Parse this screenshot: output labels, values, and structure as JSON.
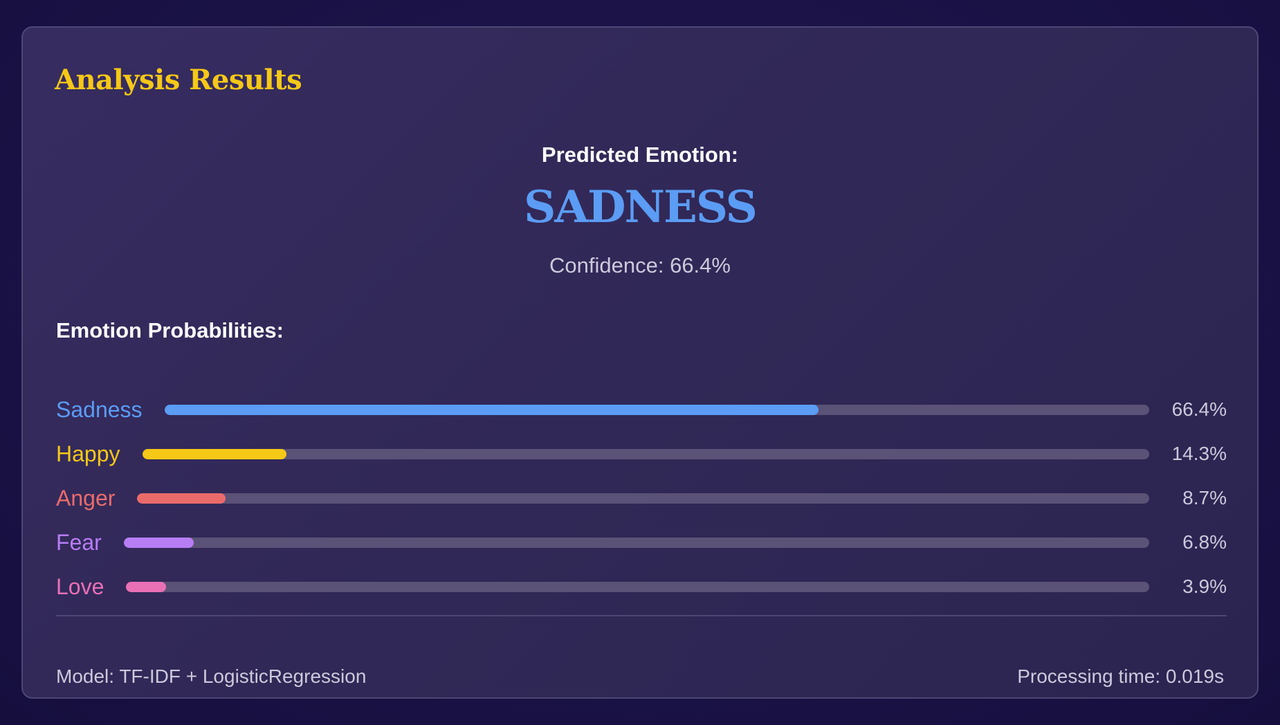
{
  "title": "Analysis Results",
  "prediction": {
    "label": "Predicted Emotion:",
    "emotion": "SADNESS",
    "emotion_color": "#5b9cf5",
    "confidence": "Confidence: 66.4%"
  },
  "probabilities_heading": "Emotion Probabilities:",
  "probabilities": [
    {
      "label": "Sadness",
      "percent_text": "66.4%",
      "value": 66.4,
      "color": "#5b9cf5"
    },
    {
      "label": "Happy",
      "percent_text": "14.3%",
      "value": 14.3,
      "color": "#f6c816"
    },
    {
      "label": "Anger",
      "percent_text": "8.7%",
      "value": 8.7,
      "color": "#eb6b6b"
    },
    {
      "label": "Fear",
      "percent_text": "6.8%",
      "value": 6.8,
      "color": "#b77df5"
    },
    {
      "label": "Love",
      "percent_text": "3.9%",
      "value": 3.9,
      "color": "#ea70b6"
    }
  ],
  "footer": {
    "model": "Model: TF-IDF + LogisticRegression",
    "processing_time": "Processing time: 0.019s"
  },
  "colors": {
    "title": "#f6c816",
    "track": "#5b5277",
    "muted_text": "#cdc9dc"
  }
}
